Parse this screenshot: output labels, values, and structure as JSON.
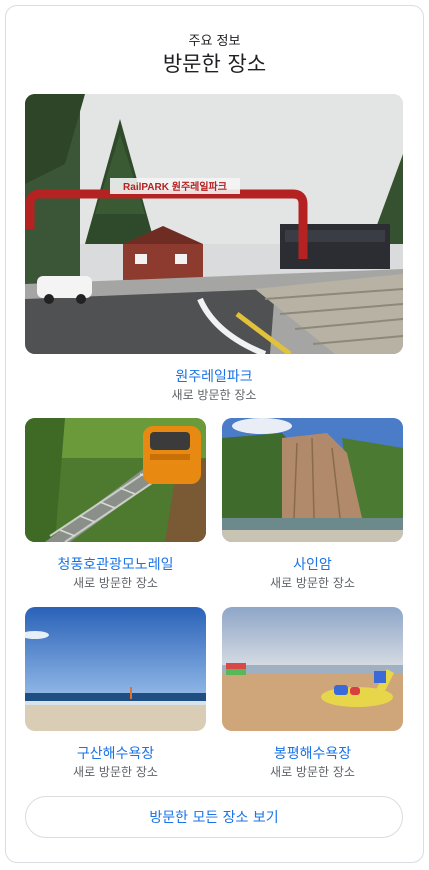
{
  "header": {
    "eyebrow": "주요 정보",
    "title": "방문한 장소"
  },
  "places": [
    {
      "name": "원주레일파크",
      "subtitle": "새로 방문한 장소",
      "sign_text": "RailPARK 원주레일파크"
    },
    {
      "name": "청풍호관광모노레일",
      "subtitle": "새로 방문한 장소"
    },
    {
      "name": "사인암",
      "subtitle": "새로 방문한 장소"
    },
    {
      "name": "구산해수욕장",
      "subtitle": "새로 방문한 장소"
    },
    {
      "name": "봉평해수욕장",
      "subtitle": "새로 방문한 장소"
    }
  ],
  "footer": {
    "view_all_label": "방문한 모든 장소 보기"
  }
}
